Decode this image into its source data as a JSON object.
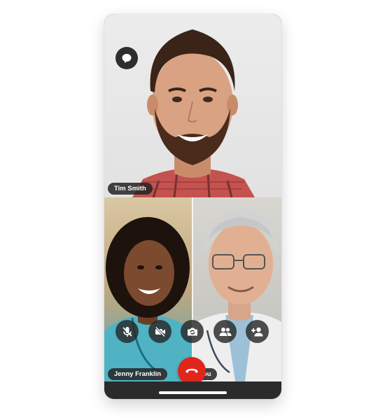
{
  "call": {
    "participants": [
      {
        "name": "Tim Smith"
      },
      {
        "name": "Jenny Franklin"
      },
      {
        "name": "ou"
      }
    ]
  },
  "controls": {
    "icons": [
      "mic-off-icon",
      "video-off-icon",
      "switch-camera-icon",
      "participants-icon",
      "add-person-icon",
      "end-call-icon",
      "chat-icon"
    ],
    "end_call_color": "#e0251b"
  }
}
